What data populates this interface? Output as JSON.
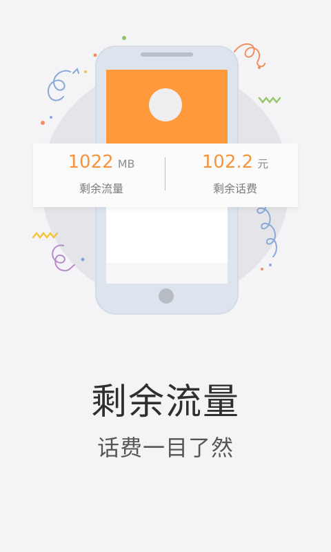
{
  "stats": {
    "data_remaining": {
      "value": "1022",
      "unit": "MB",
      "label": "剩余流量"
    },
    "balance_remaining": {
      "value": "102.2",
      "unit": "元",
      "label": "剩余话费"
    }
  },
  "headline": "剩余流量",
  "subline": "话费一目了然",
  "colors": {
    "accent": "#f7943b",
    "phone_screen": "#ff9a3c",
    "background": "#f4f4f6",
    "text_dark": "#2f2f2f"
  },
  "icons": [
    "smartphone-illustration",
    "confetti-ribbon"
  ]
}
